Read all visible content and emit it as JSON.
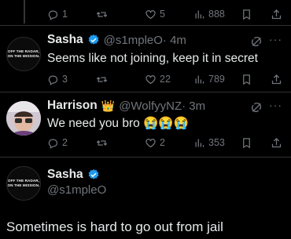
{
  "top_actions": {
    "replies": "1",
    "reposts": "",
    "likes": "5",
    "views": "888"
  },
  "tweet1": {
    "author": "Sasha",
    "handle": "@s1mpleO",
    "time": "· 4m",
    "text": "Seems like not joining, keep it in secret",
    "avatar_line1": "OFF THE RADAR,",
    "avatar_line2": "ON THE MISSION.",
    "replies": "3",
    "reposts": "",
    "likes": "22",
    "views": "789"
  },
  "tweet2": {
    "author": "Harrison",
    "crown": "👑",
    "handle": "@WolfyyNZ",
    "time": "· 3m",
    "text": "We need you bro 😭😭😭",
    "replies": "2",
    "reposts": "",
    "likes": "2",
    "views": "353"
  },
  "tweet3": {
    "author": "Sasha",
    "handle": "@s1mpleO",
    "avatar_line1": "OFF THE RADAR,",
    "avatar_line2": "ON THE MISSION.",
    "text": "Sometimes is hard to go out from jail"
  },
  "colors": {
    "verified": "#1d9bf0",
    "muted": "#71767b",
    "background": "#000000"
  },
  "icons": [
    "reply-icon",
    "repost-icon",
    "like-icon",
    "views-icon",
    "bookmark-icon",
    "share-icon",
    "grok-icon",
    "more-icon",
    "verified-badge-icon"
  ]
}
